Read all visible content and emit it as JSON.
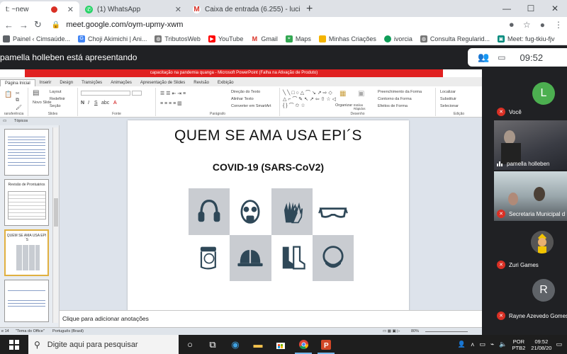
{
  "browser": {
    "tabs": [
      {
        "title": "t: ~new",
        "favicon_color": "#d93025",
        "active": true
      },
      {
        "title": "(1) WhatsApp",
        "favicon_color": "#25d366",
        "active": false
      },
      {
        "title": "Caixa de entrada (6.255) - lucian",
        "favicon_color": "#d93025",
        "active": false
      }
    ],
    "new_tab": "+",
    "url": "meet.google.com/oym-upmy-xwm",
    "bookmarks": [
      {
        "label": "Painel ‹ Cimsaúde...",
        "color": "#5f6368"
      },
      {
        "label": "Choji Akimichi | Ani...",
        "color": "#4285f4"
      },
      {
        "label": "TributosWeb",
        "color": "#777"
      },
      {
        "label": "YouTube",
        "color": "#ff0000"
      },
      {
        "label": "Gmail",
        "color": "#d93025"
      },
      {
        "label": "Maps",
        "color": "#34a853"
      },
      {
        "label": "Minhas Criações",
        "color": "#f4b400"
      },
      {
        "label": "ivorcia",
        "color": "#0f9d58"
      },
      {
        "label": "Consulta Regularid...",
        "color": "#777"
      },
      {
        "label": "Meet: fug-tkiu-fjv",
        "color": "#00897b"
      }
    ]
  },
  "meet": {
    "presenter_text": "pamella holleben está apresentando",
    "time": "09:52",
    "participants": [
      {
        "name": "Você",
        "initial": "L",
        "avatar_color": "#4caf50",
        "type": "avatar",
        "muted": true
      },
      {
        "name": "pamella holleben",
        "type": "video",
        "muted": false
      },
      {
        "name": "Secretaria Municipal d",
        "type": "video",
        "muted": true
      },
      {
        "name": "Zuri Games",
        "type": "image",
        "muted": true
      },
      {
        "name": "Rayne Azevedo Gomes",
        "initial": "R",
        "avatar_color": "#5f6368",
        "type": "avatar",
        "muted": true
      }
    ]
  },
  "powerpoint": {
    "title": "capacitação na pandemia quanga - Microsoft PowerPoint (Falha na Ativação de Produto)",
    "tabs": [
      "Página Inicial",
      "Inserir",
      "Design",
      "Transições",
      "Animações",
      "Apresentação de Slides",
      "Revisão",
      "Exibição"
    ],
    "ribbon": {
      "layout": "Layout",
      "reset": "Redefinir",
      "section": "Seção",
      "new_slide": "Novo Slide",
      "slides_group": "Slides",
      "font_group": "Fonte",
      "paragraph_group": "Parágrafo",
      "drawing_group": "Desenho",
      "editing_group": "Edição",
      "clipboard_group": "ransferência",
      "text_direction": "Direção do Texto",
      "align_text": "Alinhar Texto",
      "smartart": "Converter em SmartArt",
      "arrange": "Organizar",
      "quick_styles": "Estilos Rápidos",
      "shape_fill": "Preenchimento da Forma",
      "shape_outline": "Contorno da Forma",
      "shape_effects": "Efeitos de Forma",
      "find": "Localizar",
      "replace": "Substituir",
      "select": "Selecionar"
    },
    "thumb_tab": "Tópicos",
    "thumbs": [
      {
        "title": ""
      },
      {
        "title": "Revisão de Prontuários"
      },
      {
        "title": "QUEM SE AMA USA EPI´S"
      },
      {
        "title": ""
      }
    ],
    "slide": {
      "title": "QUEM SE AMA USA EPI´S",
      "subtitle": "COVID-19 (SARS-CoV2)",
      "icons": [
        "ear-protection-icon",
        "gas-mask-icon",
        "gloves-icon",
        "safety-glasses-icon",
        "face-shield-icon",
        "hard-hat-icon",
        "boots-icon",
        "face-mask-icon"
      ]
    },
    "notes_placeholder": "Clique para adicionar anotações",
    "status": {
      "slide": "e 14",
      "theme": "\"Tema do Office\"",
      "language": "Português (Brasil)",
      "zoom": "80%"
    }
  },
  "taskbar": {
    "search_placeholder": "Digite aqui para pesquisar",
    "lang1": "POR",
    "lang2": "PTB2",
    "time": "09:52",
    "date": "21/08/20"
  }
}
